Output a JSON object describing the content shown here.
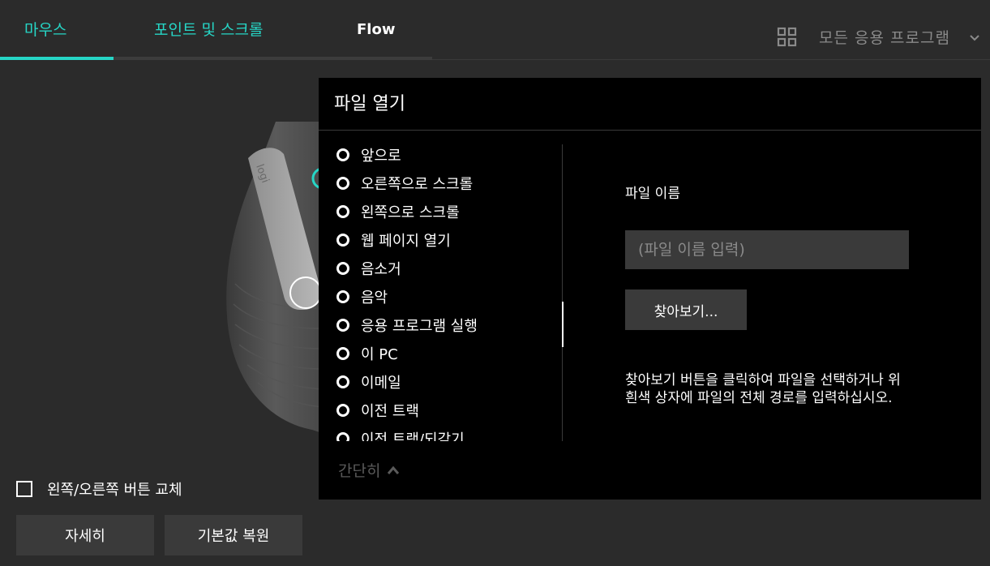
{
  "tabs": {
    "mouse": "마우스",
    "point_scroll": "포인트 및 스크롤",
    "flow": "Flow"
  },
  "app_selector": {
    "label": "모든 응용 프로그램",
    "icon": "grid-icon"
  },
  "options": {
    "swap_buttons_label": "왼쪽/오른쪽 버튼 교체",
    "swap_buttons_checked": false
  },
  "buttons": {
    "details": "자세히",
    "restore_defaults": "기본값 복원"
  },
  "panel": {
    "title": "파일 열기",
    "actions": [
      "앞으로",
      "오른쪽으로 스크롤",
      "왼쪽으로 스크롤",
      "웹 페이지 열기",
      "음소거",
      "음악",
      "응용 프로그램 실행",
      "이 PC",
      "이메일",
      "이전 트랙",
      "이전 트랙/되감기"
    ],
    "collapse_label": "간단히",
    "file_name_label": "파일 이름",
    "file_name_placeholder": "(파일 이름 입력)",
    "file_name_value": "",
    "browse_label": "찾아보기...",
    "help_text": "찾아보기 버튼을 클릭하여 파일을 선택하거나 위 흰색 상자에 파일의 전체 경로를 입력하십시오."
  },
  "colors": {
    "accent": "#26d6c6",
    "background": "#2b2b2b",
    "panel": "#000000",
    "control": "#3a3a3a"
  }
}
